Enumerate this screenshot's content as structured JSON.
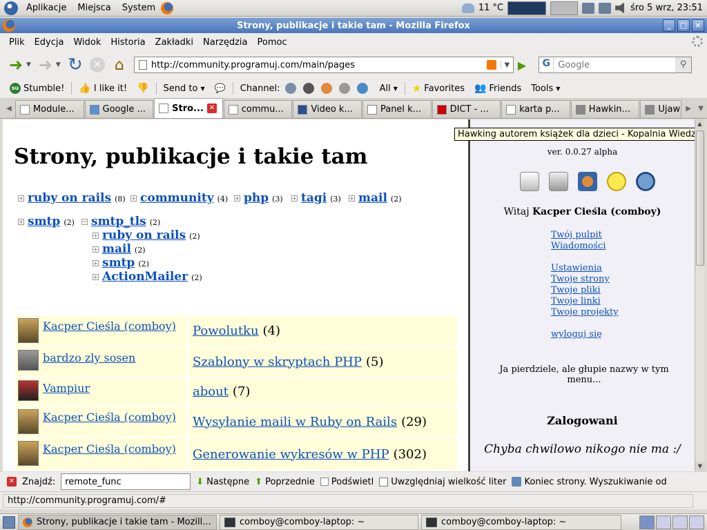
{
  "top_panel": {
    "menus": [
      "Aplikacje",
      "Miejsca",
      "System"
    ],
    "weather": "11 °C",
    "clock": "śro  5 wrz, 23:51"
  },
  "window": {
    "title": "Strony, publikacje i takie tam - Mozilla Firefox",
    "buttons": [
      "_",
      "□",
      "×"
    ]
  },
  "menubar": [
    "Plik",
    "Edycja",
    "Widok",
    "Historia",
    "Zakładki",
    "Narzędzia",
    "Pomoc"
  ],
  "navbar": {
    "url": "http://community.programuj.com/main/pages",
    "search_placeholder": "Google"
  },
  "stumblebar": {
    "stumble": "Stumble!",
    "ilike": "I like it!",
    "sendto": "Send to",
    "channel": "Channel:",
    "all": "All",
    "favorites": "Favorites",
    "friends": "Friends",
    "tools": "Tools"
  },
  "tabs": [
    {
      "label": "Module..."
    },
    {
      "label": "Google ..."
    },
    {
      "label": "Stro..."
    },
    {
      "label": "commu..."
    },
    {
      "label": "Video k..."
    },
    {
      "label": "Panel k..."
    },
    {
      "label": "DICT - ..."
    },
    {
      "label": "karta p..."
    },
    {
      "label": "Hawkin..."
    },
    {
      "label": "Ujaw"
    }
  ],
  "page": {
    "heading": "Strony, publikacje i takie tam",
    "tags_row1": [
      {
        "name": "ruby on rails",
        "count": "(8)"
      },
      {
        "name": "community",
        "count": "(4)"
      },
      {
        "name": "php",
        "count": "(3)"
      },
      {
        "name": "tagi",
        "count": "(3)"
      },
      {
        "name": "mail",
        "count": "(2)"
      }
    ],
    "tags_row2": [
      {
        "name": "smtp",
        "count": "(2)"
      },
      {
        "name": "smtp_tls",
        "count": "(2)"
      }
    ],
    "tags_sub": [
      {
        "name": "ruby on rails",
        "count": "(2)"
      },
      {
        "name": "mail",
        "count": "(2)"
      },
      {
        "name": "smtp",
        "count": "(2)"
      },
      {
        "name": "ActionMailer",
        "count": "(2)"
      }
    ],
    "rows": [
      {
        "author": "Kacper Cieśla (comboy)",
        "title": "Powolutku",
        "count": "(4)"
      },
      {
        "author": "bardzo zly sosen",
        "title": "Szablony w skryptach PHP",
        "count": "(5)"
      },
      {
        "author": "Vampiur",
        "title": "about",
        "count": "(7)"
      },
      {
        "author": "Kacper Cieśla (comboy)",
        "title": "Wysyłanie maili w Ruby on Rails",
        "count": "(29)"
      },
      {
        "author": "Kacper Cieśla (comboy)",
        "title": "Generowanie wykresów w PHP",
        "count": "(302)"
      }
    ]
  },
  "sidebar": {
    "tooltip": "Hawking autorem książek dla dzieci - Kopalnia Wiedzy",
    "version": "ver. 0.0.27 alpha",
    "welcome_prefix": "Witaj ",
    "welcome_user": "Kacper Cieśla (comboy)",
    "links": [
      "Twój pulpit",
      "Wiadomości",
      "Ustawienia",
      "Twoje strony",
      "Twoje pliki",
      "Twoje linki",
      "Twoje projekty",
      "wyloguj się"
    ],
    "note": "Ja pierdziele, ale głupie nazwy w tym menu...",
    "logged_title": "Zalogowani",
    "nobody": "Chyba chwilowo nikogo nie ma :/"
  },
  "findbar": {
    "label": "Znajdź:",
    "value": "remote_func",
    "next": "Następne",
    "prev": "Poprzednie",
    "highlight": "Podświetl",
    "match_case": "Uwzględniaj wielkość liter",
    "status": "Koniec strony. Wyszukiwanie od"
  },
  "statusbar": {
    "text": "http://community.programuj.com/#"
  },
  "taskbar": [
    {
      "label": "Strony, publikacje i takie tam - Mozill..."
    },
    {
      "label": "comboy@comboy-laptop: ~"
    },
    {
      "label": "comboy@comboy-laptop: ~"
    }
  ]
}
